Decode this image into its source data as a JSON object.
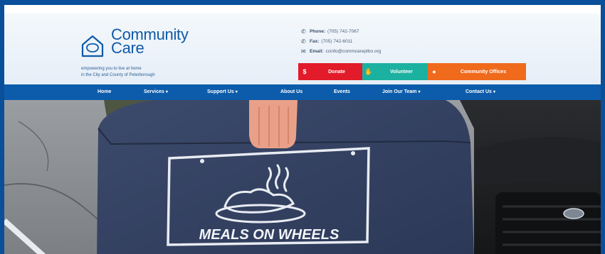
{
  "brand": {
    "name_line1": "Community",
    "name_line2": "Care",
    "tagline_line1": "empowering you to live at home",
    "tagline_line2": "in the City and County of Peterborough"
  },
  "contact": {
    "phone_label": "Phone:",
    "phone": "(705) 742-7067",
    "fax_label": "Fax:",
    "fax": "(705) 742-6011",
    "email_label": "Email:",
    "email": "ccinfo@commcareptbo.org"
  },
  "buttons": {
    "donate": "Donate",
    "volunteer": "Volunteer",
    "offices": "Community Offices"
  },
  "nav": {
    "home": "Home",
    "services": "Services",
    "support": "Support Us",
    "about": "About Us",
    "events": "Events",
    "team": "Join Our Team",
    "contact": "Contact Us"
  },
  "hero": {
    "bag_text": "MEALS ON WHEELS"
  },
  "colors": {
    "brand_blue": "#0c5cab",
    "donate_red": "#e21b2a",
    "volunteer_teal": "#1bb1a0",
    "offices_orange": "#f06a1c"
  },
  "icons": {
    "logo": "house-outline-icon",
    "phone": "phone-icon",
    "fax": "fax-icon",
    "email": "envelope-icon",
    "donate": "dollar-icon",
    "volunteer": "hand-icon",
    "offices": "location-pin-icon",
    "dropdown": "caret-down-icon"
  }
}
